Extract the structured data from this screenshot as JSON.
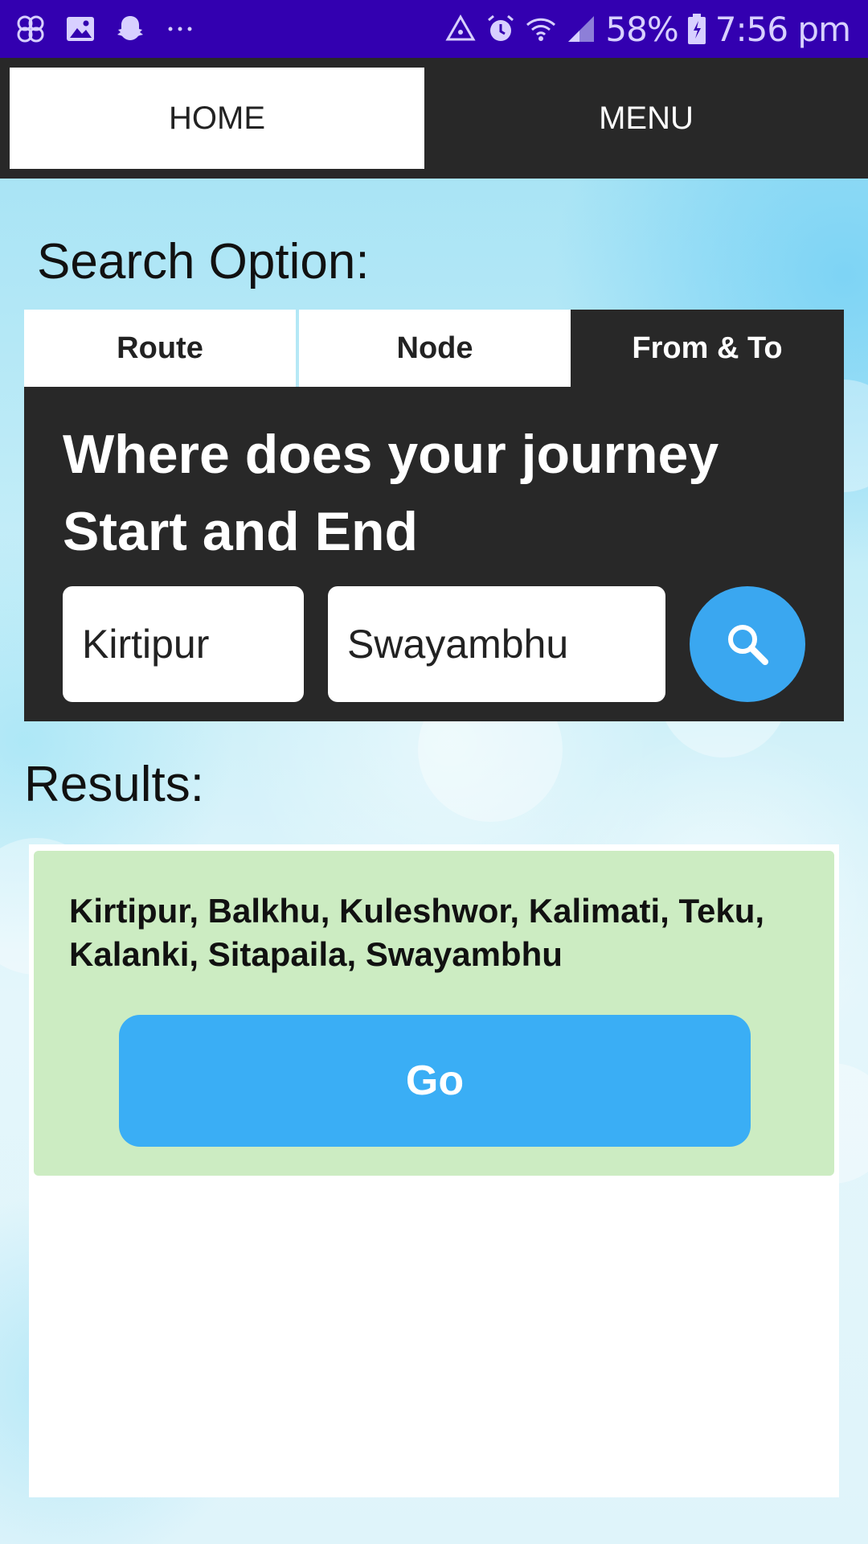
{
  "status_bar": {
    "battery": "58%",
    "time": "7:56 pm",
    "left_icons": [
      "pinwheel-icon",
      "gallery-icon",
      "snapchat-icon",
      "more-dots-icon"
    ],
    "right_icons": [
      "recycle-icon",
      "alarm-icon",
      "wifi-icon",
      "signal-icon",
      "battery-icon"
    ]
  },
  "nav": {
    "home_label": "HOME",
    "menu_label": "MENU"
  },
  "search": {
    "heading": "Search Option:",
    "tabs": [
      {
        "label": "Route",
        "active": false
      },
      {
        "label": "Node",
        "active": false
      },
      {
        "label": "From & To",
        "active": true
      }
    ],
    "prompt_line1": "Where does your journey",
    "prompt_line2": "Start and End",
    "from_value": "Kirtipur",
    "to_value": "Swayambhu",
    "search_button_icon": "search-icon"
  },
  "results": {
    "heading": "Results:",
    "items": [
      {
        "route": "Kirtipur, Balkhu, Kuleshwor, Kalimati, Teku, Kalanki, Sitapaila, Swayambhu",
        "go_label": "Go"
      }
    ]
  },
  "colors": {
    "status_bar": "#3300b0",
    "nav_bar": "#282828",
    "accent_blue": "#3aa7f0",
    "result_card": "#ccecc2"
  }
}
